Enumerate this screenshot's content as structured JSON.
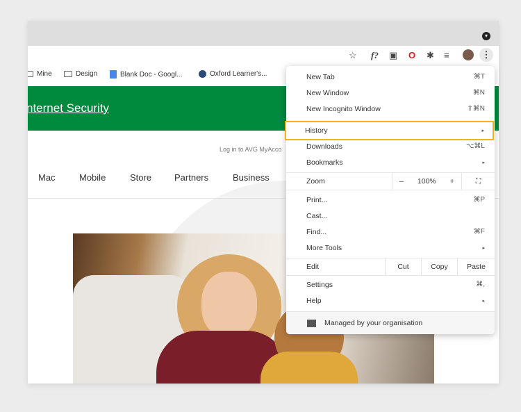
{
  "toolbar": {
    "icons": [
      "star-icon",
      "formula-icon",
      "monitor-icon",
      "opera-icon",
      "puzzle-icon",
      "reading-list-icon",
      "avatar",
      "kebab-menu-icon"
    ]
  },
  "bookmarks": [
    {
      "label": "Mine",
      "icon": "folder-icon"
    },
    {
      "label": "Design",
      "icon": "folder-icon"
    },
    {
      "label": "Blank Doc - Googl...",
      "icon": "google-doc-icon"
    },
    {
      "label": "Oxford Learner's...",
      "icon": "globe-icon"
    }
  ],
  "page": {
    "brand": "nternet Security",
    "login": "Log in to AVG MyAcco",
    "nav": [
      "Mac",
      "Mobile",
      "Store",
      "Partners",
      "Business"
    ],
    "brand_color": "#008a3e"
  },
  "menu": {
    "new_tab": {
      "label": "New Tab",
      "shortcut": "⌘T"
    },
    "new_window": {
      "label": "New Window",
      "shortcut": "⌘N"
    },
    "incognito": {
      "label": "New Incognito Window",
      "shortcut": "⇧⌘N"
    },
    "history": {
      "label": "History",
      "arrow": "▸"
    },
    "downloads": {
      "label": "Downloads",
      "shortcut": "⌥⌘L"
    },
    "bookmarks": {
      "label": "Bookmarks",
      "arrow": "▸"
    },
    "zoom": {
      "label": "Zoom",
      "minus": "–",
      "value": "100%",
      "plus": "+",
      "fullscreen": "⛶"
    },
    "print": {
      "label": "Print...",
      "shortcut": "⌘P"
    },
    "cast": {
      "label": "Cast..."
    },
    "find": {
      "label": "Find...",
      "shortcut": "⌘F"
    },
    "more_tools": {
      "label": "More Tools",
      "arrow": "▸"
    },
    "edit": {
      "label": "Edit",
      "cut": "Cut",
      "copy": "Copy",
      "paste": "Paste"
    },
    "settings": {
      "label": "Settings",
      "shortcut": "⌘,"
    },
    "help": {
      "label": "Help",
      "arrow": "▸"
    },
    "managed": "Managed by your organisation",
    "highlight_color": "#f6b21b"
  }
}
